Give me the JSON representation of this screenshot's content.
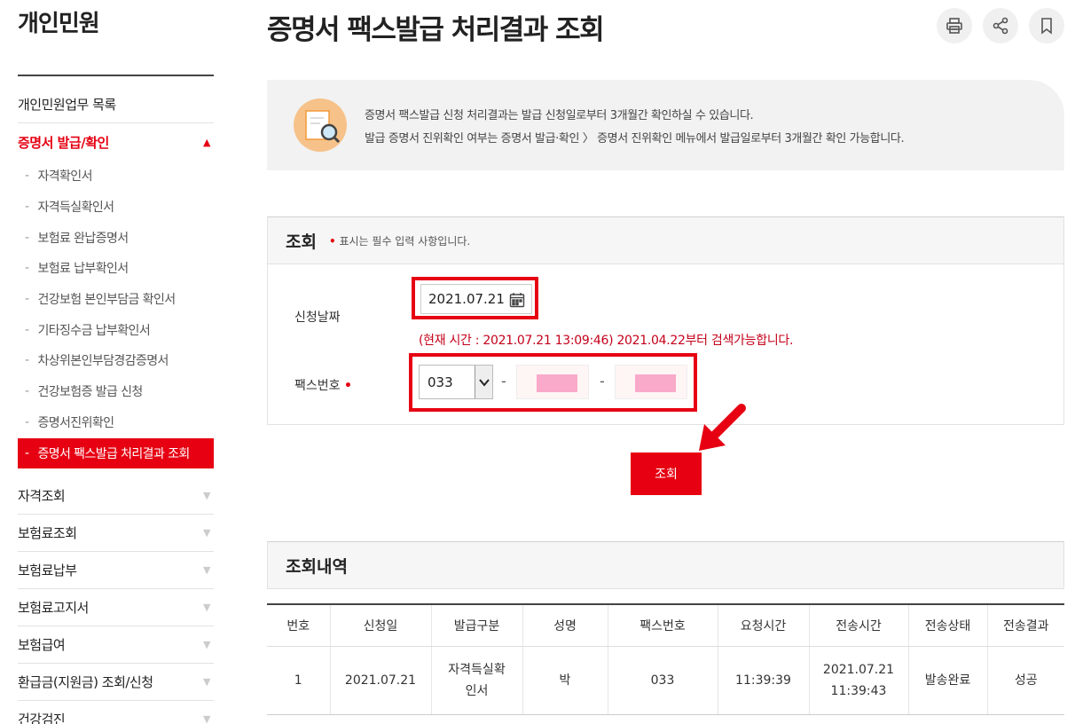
{
  "sidebar": {
    "title": "개인민원",
    "menu_top": "개인민원업무 목록",
    "active_section": "증명서 발급/확인",
    "sub_items": [
      "자격확인서",
      "자격득실확인서",
      "보험료 완납증명서",
      "보험료 납부확인서",
      "건강보험 본인부담금 확인서",
      "기타징수금 납부확인서",
      "차상위본인부담경감증명서",
      "건강보험증 발급 신청",
      "증명서진위확인"
    ],
    "current_item": "증명서 팩스발급 처리결과 조회",
    "sections": [
      "자격조회",
      "보험료조회",
      "보험료납부",
      "보험료고지서",
      "보험급여",
      "환급금(지원금) 조회/신청",
      "건강검진"
    ]
  },
  "header": {
    "title": "증명서 팩스발급 처리결과 조회"
  },
  "info": {
    "line1": "증명서 팩스발급 신청 처리결과는 발급 신청일로부터 3개월간 확인하실 수 있습니다.",
    "line2": "발급 증명서 진위확인 여부는 증명서 발급·확인 〉 증명서 진위확인 메뉴에서 발급일로부터 3개월간 확인 가능합니다."
  },
  "search": {
    "title": "조회",
    "required_note": "표시는 필수 입력 사항입니다.",
    "date_label": "신청날짜",
    "date_value": "2021.07.21",
    "hint": "(현재 시간 : 2021.07.21 13:09:46) 2021.04.22부터 검색가능합니다.",
    "fax_label": "팩스번호",
    "fax_prefix": "033",
    "sep": "-",
    "button": "조회"
  },
  "results": {
    "title": "조회내역",
    "columns": [
      "번호",
      "신청일",
      "발급구분",
      "성명",
      "팩스번호",
      "요청시간",
      "전송시간",
      "전송상태",
      "전송결과"
    ],
    "rows": [
      {
        "no": "1",
        "date": "2021.07.21",
        "type": "자격득실확\n인서",
        "name": "박",
        "fax": "033",
        "req": "11:39:39",
        "sent": "2021.07.21\n11:39:43",
        "status": "발송완료",
        "result": "성공"
      }
    ]
  },
  "colors": {
    "accent": "#e60012",
    "hint": "#c4001a",
    "mask": "#f9a9c9"
  }
}
